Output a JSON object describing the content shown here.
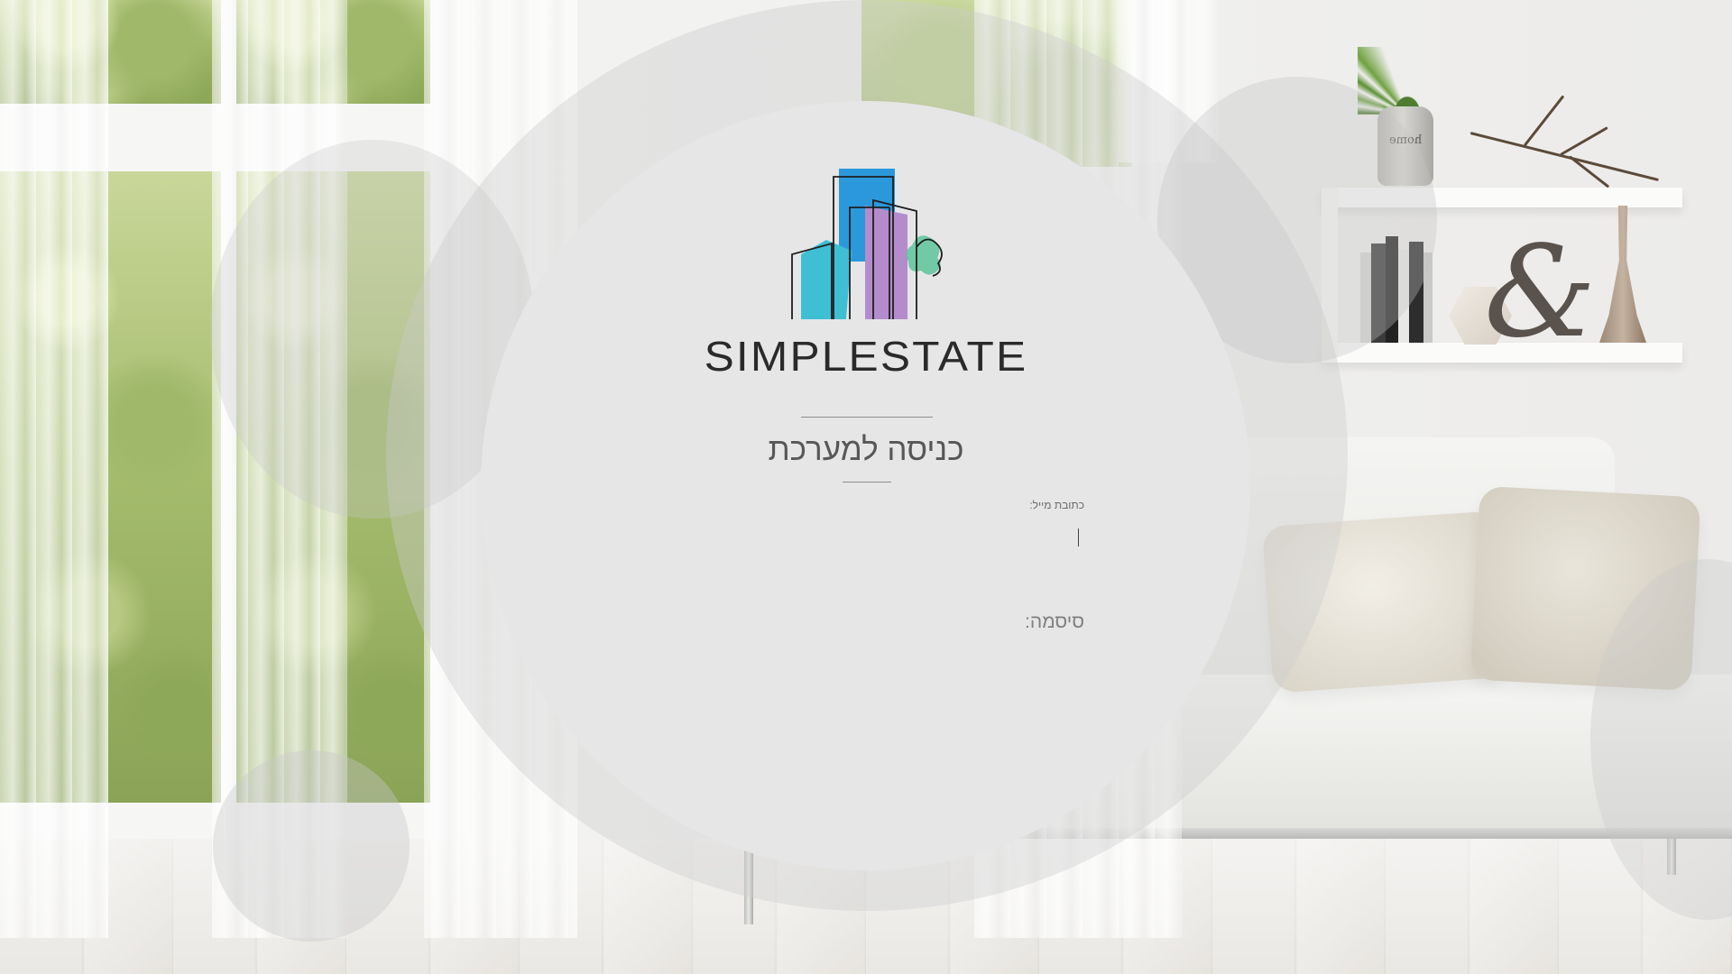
{
  "brand": {
    "name": "SIMPLESTATE",
    "logo": "simplestate-buildings-logo",
    "colors": {
      "cyan": "#3fbfd3",
      "blue": "#2b98db",
      "purple": "#b48ccc",
      "green": "#5cc39a",
      "outline": "#1f1f1f"
    }
  },
  "login": {
    "title": "כניסה למערכת",
    "email": {
      "label": "כתובת מייל:",
      "value": "",
      "placeholder": ""
    },
    "password": {
      "label": "סיסמה:",
      "value": "",
      "placeholder": ""
    }
  },
  "background": {
    "vase_text": "home",
    "circle_color": "#e6e6e6"
  }
}
